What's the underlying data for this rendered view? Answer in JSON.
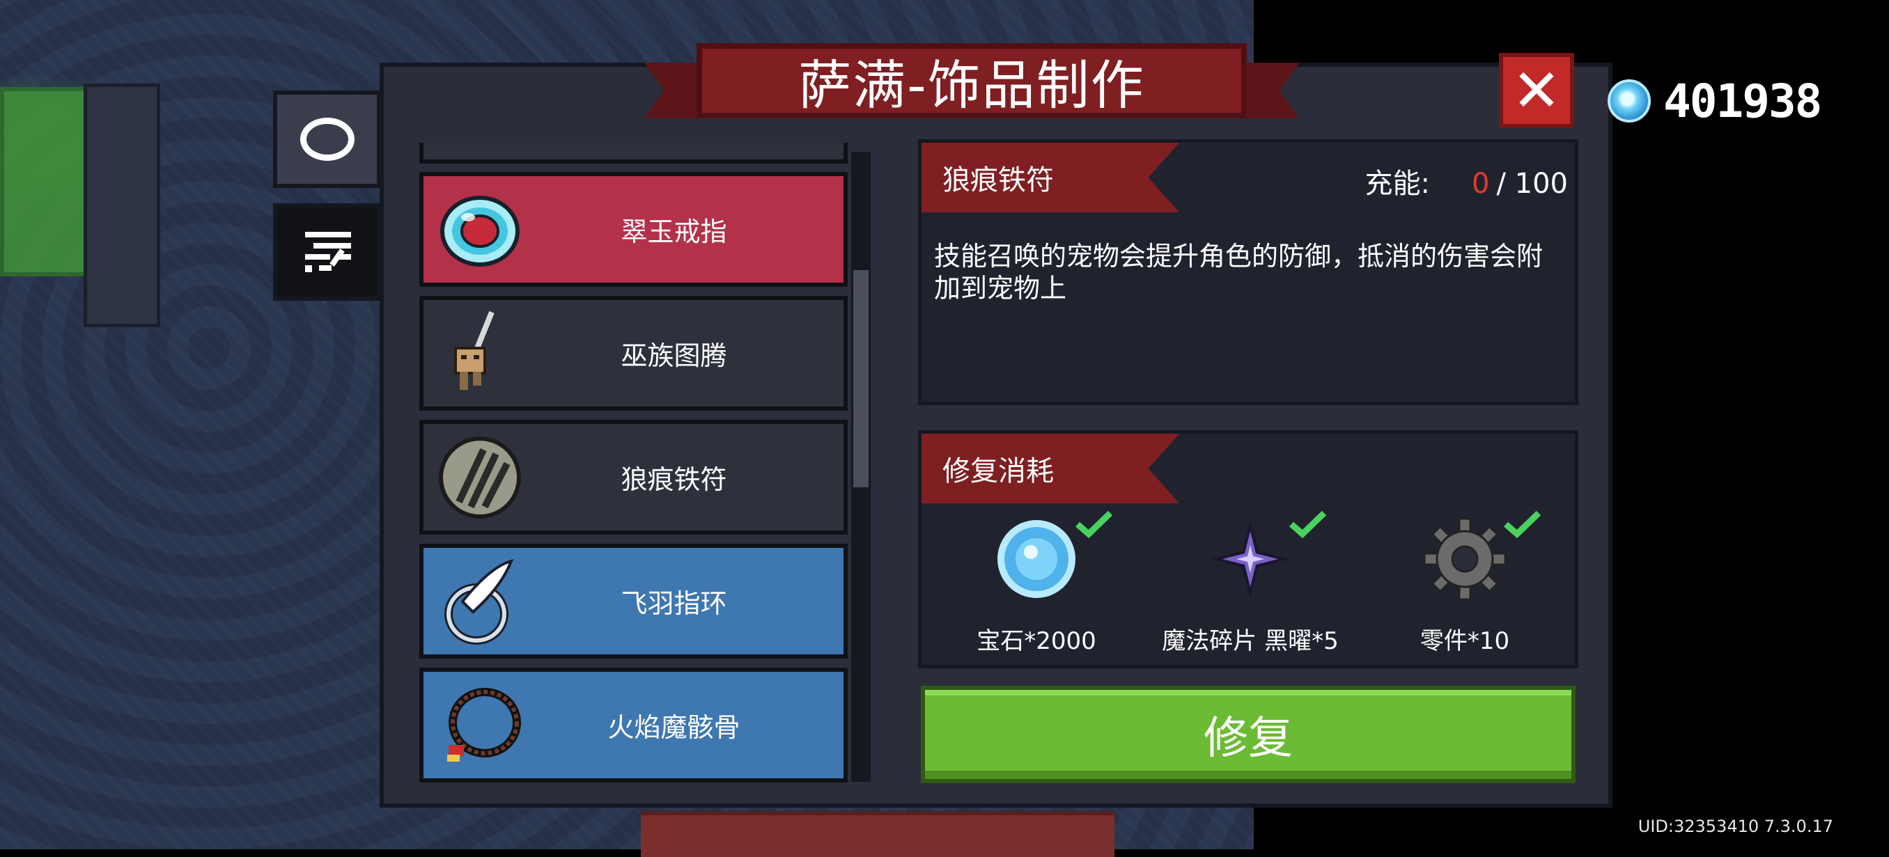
{
  "window": {
    "title": "萨满-饰品制作"
  },
  "currency": {
    "icon": "gem-icon",
    "value": "401938"
  },
  "tabs": [
    {
      "name": "ring-tab",
      "icon": "ring-icon"
    },
    {
      "name": "filter-tab",
      "icon": "filter-icon"
    }
  ],
  "items": [
    {
      "label": "翠玉戒指",
      "icon": "jade-ring-icon",
      "state": "selected"
    },
    {
      "label": "巫族图腾",
      "icon": "totem-icon",
      "state": "normal"
    },
    {
      "label": "狼痕铁符",
      "icon": "claw-talisman-icon",
      "state": "normal"
    },
    {
      "label": "飞羽指环",
      "icon": "feather-ring-icon",
      "state": "owned"
    },
    {
      "label": "火焰魔骸骨",
      "icon": "bone-necklace-icon",
      "state": "owned"
    }
  ],
  "detail": {
    "name": "狼痕铁符",
    "charge_label": "充能:",
    "charge_current": "0",
    "charge_max": "/ 100",
    "description": "技能召唤的宠物会提升角色的防御，抵消的伤害会附加到宠物上"
  },
  "cost": {
    "title": "修复消耗",
    "items": [
      {
        "label": "宝石*2000",
        "icon": "gem-icon",
        "met": true
      },
      {
        "label": "魔法碎片 黑曜*5",
        "icon": "obsidian-shard-icon",
        "met": true
      },
      {
        "label": "零件*10",
        "icon": "gear-part-icon",
        "met": true
      }
    ]
  },
  "buttons": {
    "repair": "修复",
    "close": "✕"
  },
  "footer": {
    "uid": "UID:32353410 7.3.0.17"
  },
  "colors": {
    "accent_red": "#7f1f22",
    "selected": "#b4314a",
    "owned": "#3f77b0",
    "repair": "#6cbb35",
    "charge_current": "#e23b2b"
  }
}
